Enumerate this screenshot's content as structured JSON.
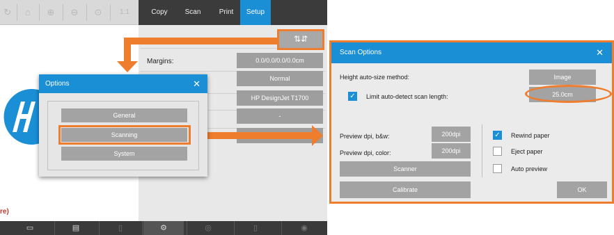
{
  "toolbar": {
    "icons": [
      "arrow-icon",
      "home-icon",
      "zoom-in-icon",
      "zoom-out-icon",
      "zoom-fit-icon"
    ],
    "zoom_label": "1:1"
  },
  "tabs": [
    {
      "label": "Copy",
      "active": false
    },
    {
      "label": "Scan",
      "active": false
    },
    {
      "label": "Print",
      "active": false
    },
    {
      "label": "Setup",
      "active": true
    }
  ],
  "settings_button": {
    "glyph": "⇅⇵"
  },
  "main": {
    "margins_label": "Margins:",
    "values": [
      "0.0/0.0/0.0/0.0cm",
      "Normal",
      "HP DesignJet T1700",
      "-"
    ]
  },
  "status": {
    "text": "re)"
  },
  "bottom_bar": {
    "items": [
      {
        "glyph": "▭",
        "dim": false,
        "active": false
      },
      {
        "glyph": "▤",
        "dim": false,
        "active": false
      },
      {
        "glyph": "▯",
        "dim": true,
        "active": false
      },
      {
        "glyph": "⚙",
        "dim": false,
        "active": true
      },
      {
        "glyph": "◎",
        "dim": true,
        "active": false
      },
      {
        "glyph": "▯",
        "dim": true,
        "active": false
      },
      {
        "glyph": "◉",
        "dim": true,
        "active": false
      }
    ]
  },
  "options_dialog": {
    "title": "Options",
    "close": "✕",
    "buttons": [
      "General",
      "Scanning",
      "System"
    ]
  },
  "scan_dialog": {
    "title": "Scan Options",
    "close": "✕",
    "height_label": "Height auto-size method:",
    "height_value": "Image",
    "limit_label": "Limit auto-detect scan length:",
    "limit_checked": true,
    "limit_value": "25.0cm",
    "preview_bw_label": "Preview dpi, b&w:",
    "preview_bw_value": "200dpi",
    "preview_color_label": "Preview dpi, color:",
    "preview_color_value": "200dpi",
    "scanner_button": "Scanner",
    "calibrate_button": "Calibrate",
    "ok_button": "OK",
    "options": [
      {
        "label": "Rewind paper",
        "checked": true
      },
      {
        "label": "Eject paper",
        "checked": false
      },
      {
        "label": "Auto preview",
        "checked": false
      }
    ]
  },
  "colors": {
    "accent": "#1a8fd6",
    "highlight": "#ee7d2d",
    "tab_bar": "#3b3b3b",
    "button_gray": "#a3a3a3"
  }
}
